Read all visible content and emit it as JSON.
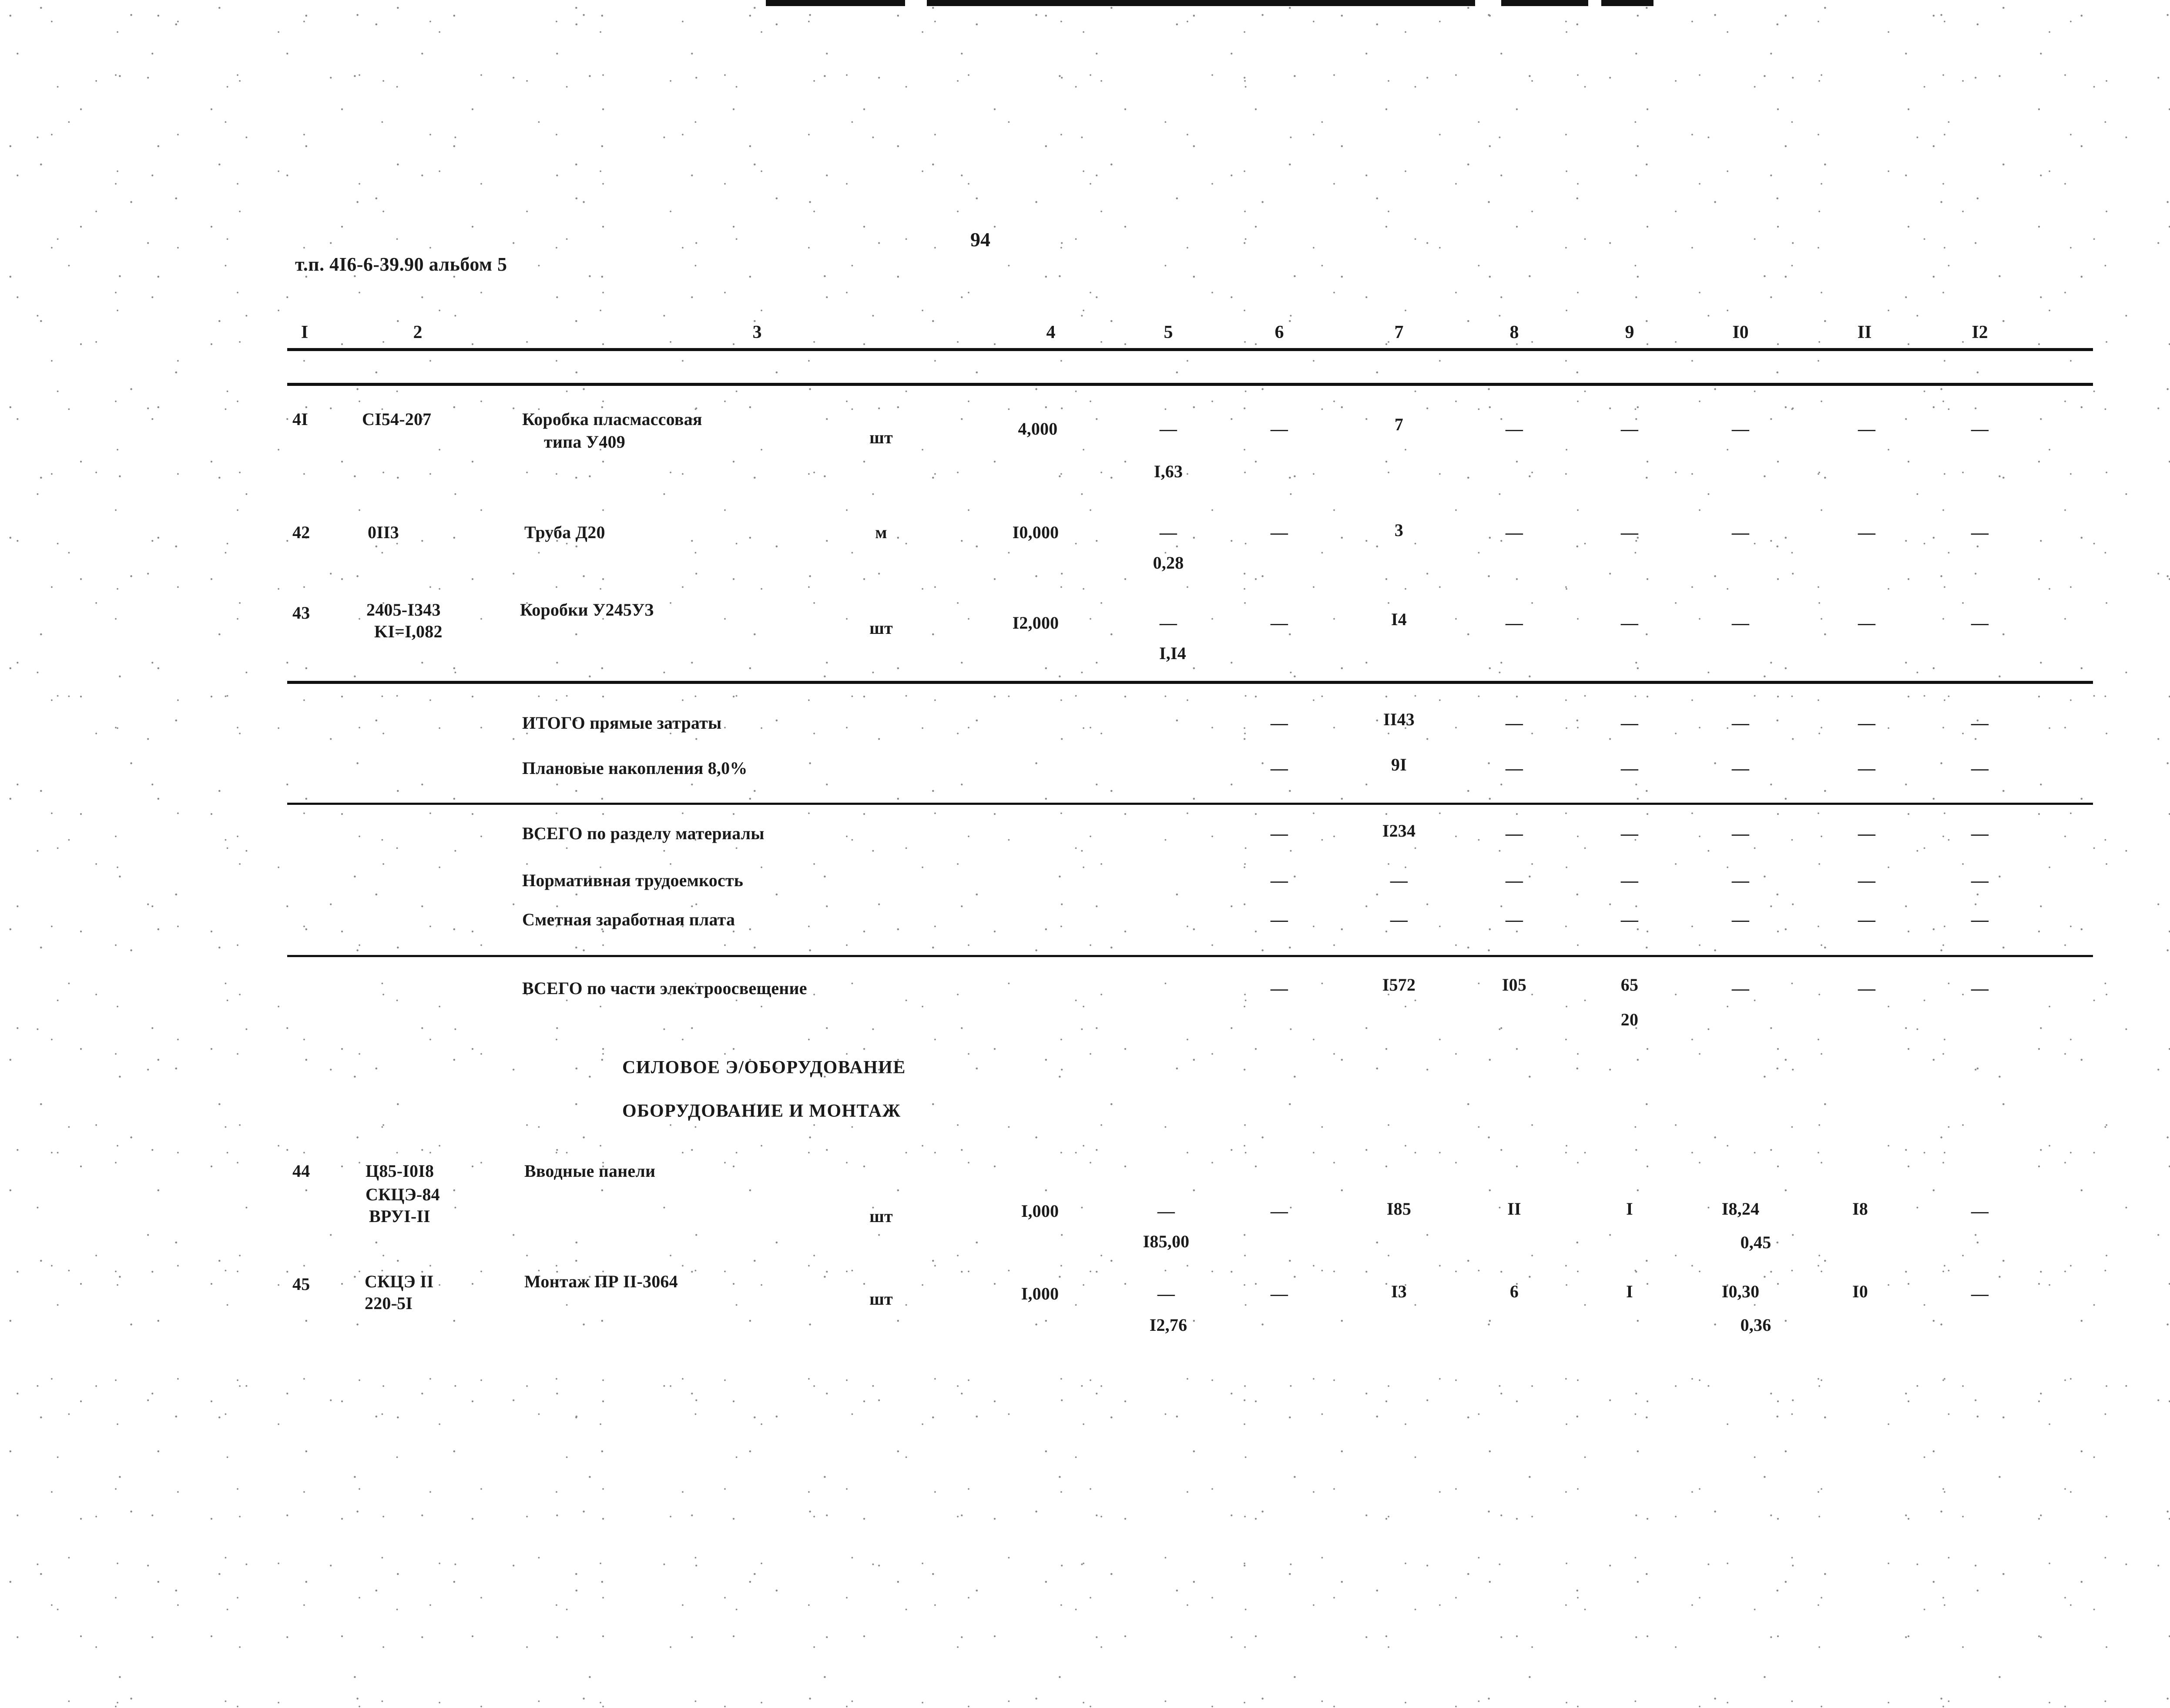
{
  "document": {
    "header_code": "т.п. 4I6-6-39.90  альбом 5",
    "page_number": "94"
  },
  "table": {
    "column_headers": [
      "I",
      "2",
      "3",
      "4",
      "5",
      "6",
      "7",
      "8",
      "9",
      "I0",
      "II",
      "I2"
    ],
    "dash": "—",
    "rows": [
      {
        "num": "4I",
        "code": "CI54-207",
        "code2": "",
        "code3": "",
        "name": "Коробка пласмассовая",
        "name2": "типа У409",
        "unit": "шт",
        "qty": "4,000",
        "price": "",
        "price2": "I,63",
        "c6": "—",
        "c7": "7",
        "c8": "—",
        "c9": "—",
        "c10": "—",
        "c10b": "",
        "c11": "—",
        "c12": "—"
      },
      {
        "num": "42",
        "code": "0II3",
        "code2": "",
        "code3": "",
        "name": "Труба Д20",
        "name2": "",
        "unit": "м",
        "qty": "I0,000",
        "price": "",
        "price2": "0,28",
        "c6": "—",
        "c7": "3",
        "c8": "—",
        "c9": "—",
        "c10": "—",
        "c10b": "",
        "c11": "—",
        "c12": "—"
      },
      {
        "num": "43",
        "code": "2405-I343",
        "code2": "KI=I,082",
        "code3": "",
        "name": "Коробки У245УЗ",
        "name2": "",
        "unit": "шт",
        "qty": "I2,000",
        "price": "",
        "price2": "I,I4",
        "c6": "—",
        "c7": "I4",
        "c8": "—",
        "c9": "—",
        "c10": "—",
        "c10b": "",
        "c11": "—",
        "c12": "—"
      },
      {
        "num": "44",
        "code": "Ц85-I0I8",
        "code2": "СКЦЭ-84",
        "code3": "ВРУI-II",
        "name": "Вводные панели",
        "name2": "",
        "unit": "шт",
        "qty": "I,000",
        "price": "",
        "price2": "I85,00",
        "c6": "—",
        "c7": "I85",
        "c8": "II",
        "c9": "I",
        "c10": "I8,24",
        "c10b": "0,45",
        "c11": "I8",
        "c12": "—"
      },
      {
        "num": "45",
        "code": "СКЦЭ II",
        "code2": "220-5I",
        "code3": "",
        "name": "Монтаж ПР II-3064",
        "name2": "",
        "unit": "шт",
        "qty": "I,000",
        "price": "",
        "price2": "I2,76",
        "c6": "—",
        "c7": "I3",
        "c8": "6",
        "c9": "I",
        "c10": "I0,30",
        "c10b": "0,36",
        "c11": "I0",
        "c12": "—"
      }
    ],
    "summary_block_1": [
      {
        "label": "ИТОГО прямые затраты",
        "c6": "—",
        "c7": "II43",
        "c8": "—",
        "c9": "—",
        "c10": "—",
        "c11": "—",
        "c12": "—"
      },
      {
        "label": "Плановые накопления  8,0%",
        "c6": "—",
        "c7": "9I",
        "c8": "—",
        "c9": "—",
        "c10": "—",
        "c11": "—",
        "c12": "—"
      }
    ],
    "summary_block_2": [
      {
        "label": "ВСЕГО по разделу   материалы",
        "c6": "—",
        "c7": "I234",
        "c8": "—",
        "c9": "—",
        "c10": "—",
        "c11": "—",
        "c12": "—"
      },
      {
        "label": "Нормативная трудоемкость",
        "c6": "—",
        "c7": "—",
        "c8": "—",
        "c9": "—",
        "c10": "—",
        "c11": "—",
        "c12": "—"
      },
      {
        "label": "Сметная заработная плата",
        "c6": "—",
        "c7": "—",
        "c8": "—",
        "c9": "—",
        "c10": "—",
        "c11": "—",
        "c12": "—"
      }
    ],
    "grand_total": {
      "label": "ВСЕГО  по части   электроосвещение",
      "c6": "—",
      "c7": "I572",
      "c8": "I05",
      "c9": "65",
      "c9b": "20",
      "c10": "—",
      "c11": "—",
      "c12": "—"
    },
    "section_titles": [
      "СИЛОВОЕ Э/ОБОРУДОВАНИЕ",
      "ОБОРУДОВАНИЕ И МОНТАЖ"
    ]
  }
}
